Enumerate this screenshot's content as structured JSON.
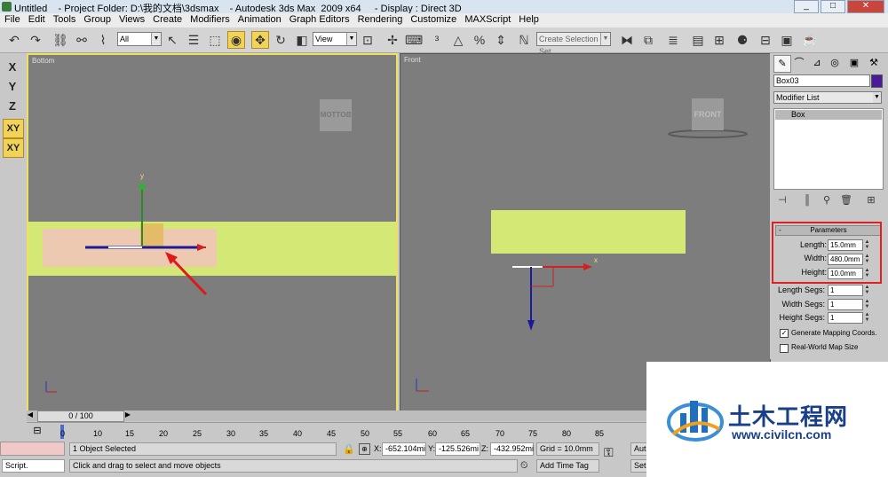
{
  "window": {
    "title": "Untitled    - Project Folder: D:\\我的文档\\3dsmax    - Autodesk 3ds Max  2009 x64     - Display : Direct 3D",
    "buttons": [
      "_",
      "□",
      "✕"
    ]
  },
  "menu": [
    "File",
    "Edit",
    "Tools",
    "Group",
    "Views",
    "Create",
    "Modifiers",
    "Animation",
    "Graph Editors",
    "Rendering",
    "Customize",
    "MAXScript",
    "Help"
  ],
  "toolbar": {
    "filter_value": "All",
    "refcoord_value": "View",
    "selection_set_placeholder": "Create Selection Set"
  },
  "axis_buttons": [
    "X",
    "Y",
    "Z",
    "XY",
    "XY"
  ],
  "viewports": {
    "left": {
      "label": "Bottom",
      "viewcube": "BOTTOM",
      "gizmo_y": "y"
    },
    "right": {
      "label": "Front",
      "viewcube": "FRONT",
      "gizmo_x": "x"
    }
  },
  "command_panel": {
    "object_name": "Box03",
    "object_color": "#4b1a9a",
    "modifier_list": "Modifier List",
    "stack_item": "Box",
    "rollout_toggle": "-",
    "rollout_title": "Parameters",
    "params": [
      {
        "label": "Length:",
        "value": "15.0mm"
      },
      {
        "label": "Width:",
        "value": "480.0mm"
      },
      {
        "label": "Height:",
        "value": "10.0mm"
      }
    ],
    "segs": [
      {
        "label": "Length Segs:",
        "value": "1"
      },
      {
        "label": "Width Segs:",
        "value": "1"
      },
      {
        "label": "Height Segs:",
        "value": "1"
      }
    ],
    "generate_mapping": {
      "label": "Generate Mapping Coords.",
      "checked": true
    },
    "real_world": {
      "label": "Real-World Map Size",
      "checked": false
    }
  },
  "time_slider": {
    "label": "0 / 100"
  },
  "track_ticks": [
    "0",
    "10",
    "15",
    "20",
    "25",
    "30",
    "35",
    "40",
    "45",
    "50",
    "55",
    "60",
    "65",
    "70",
    "75",
    "80",
    "85"
  ],
  "status": {
    "selection": "1 Object Selected",
    "prompt": "Click and drag to select and move objects",
    "script_label": "Script.",
    "x_label": "X:",
    "x_value": "-652.104mi",
    "y_label": "Y:",
    "y_value": "-125.526mi",
    "z_label": "Z:",
    "z_value": "-432.952mi",
    "grid": "Grid = 10.0mm",
    "add_time_tag": "Add Time Tag",
    "auto": "Auto",
    "set": "Set"
  },
  "watermark": {
    "title": "土木工程网",
    "url": "www.civilcn.com"
  }
}
